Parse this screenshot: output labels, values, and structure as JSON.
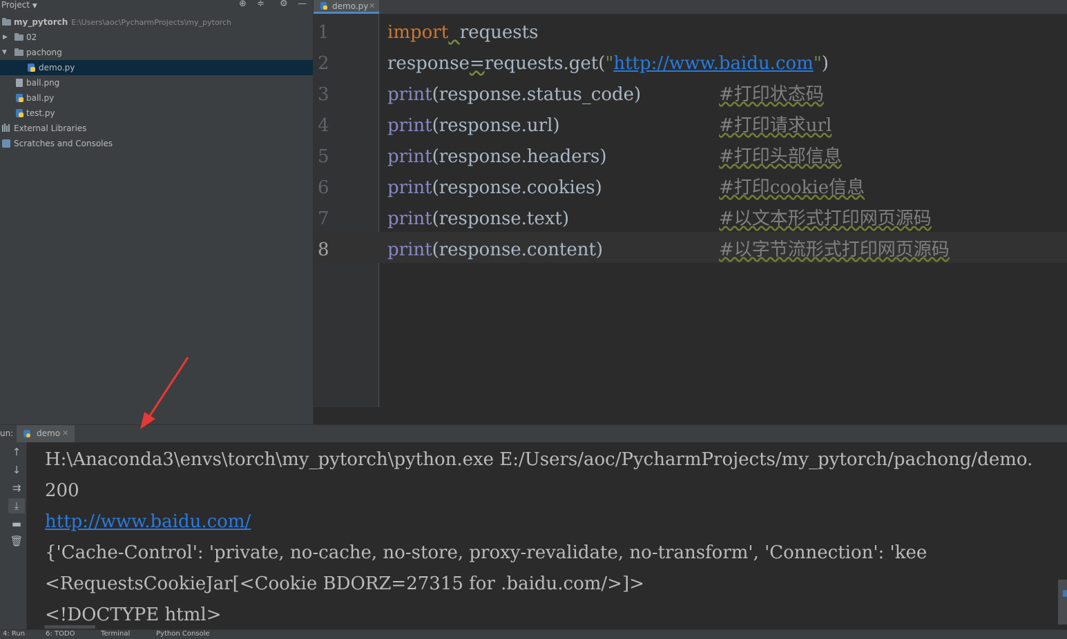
{
  "project_panel": {
    "title": "Project",
    "toolbar_icons": [
      "locate-icon",
      "collapse-icon",
      "gear-icon",
      "minimize-icon"
    ],
    "root": {
      "name": "my_pytorch",
      "path": "E:\\Users\\aoc\\PycharmProjects\\my_pytorch"
    },
    "items": [
      {
        "label": "02"
      },
      {
        "label": "pachong"
      },
      {
        "label": "demo.py"
      },
      {
        "label": "ball.png"
      },
      {
        "label": "ball.py"
      },
      {
        "label": "test.py"
      },
      {
        "label": "External Libraries"
      },
      {
        "label": "Scratches and Consoles"
      }
    ]
  },
  "editor": {
    "active_tab": "demo.py",
    "line_numbers": [
      "1",
      "2",
      "3",
      "4",
      "5",
      "6",
      "7",
      "8"
    ],
    "current_line": 8,
    "lines": [
      {
        "kw": "import",
        "space": "  ",
        "rest": "requests"
      },
      {
        "pre": "response",
        "eq": "=",
        "mid": "requests.get(",
        "q1": "\"",
        "url": "http://www.baidu.com",
        "q2": "\"",
        "post": ")"
      },
      {
        "fn": "print",
        "arg": "(response.status_code)",
        "comment": "#打印状态码"
      },
      {
        "fn": "print",
        "arg": "(response.url)",
        "comment": "#打印请求url"
      },
      {
        "fn": "print",
        "arg": "(response.headers)",
        "comment": "#打印头部信息"
      },
      {
        "fn": "print",
        "arg": "(response.cookies)",
        "comment": "#打印cookie信息"
      },
      {
        "fn": "print",
        "arg": "(response.text)",
        "comment": "#以文本形式打印网页源码"
      },
      {
        "fn": "print",
        "arg": "(response.content)",
        "comment": "#以字节流形式打印网页源码"
      }
    ]
  },
  "run": {
    "label": "un:",
    "tab": "demo",
    "toolbar_icons": [
      "up-arrow-icon",
      "down-arrow-icon",
      "soft-wrap-icon",
      "scroll-to-end-icon",
      "print-icon",
      "trash-icon"
    ],
    "output": [
      "H:\\Anaconda3\\envs\\torch\\my_pytorch\\python.exe E:/Users/aoc/PycharmProjects/my_pytorch/pachong/demo.",
      "200",
      "http://www.baidu.com/",
      "{'Cache-Control': 'private, no-cache, no-store, proxy-revalidate, no-transform', 'Connection': 'kee",
      "<RequestsCookieJar[<Cookie BDORZ=27315 for .baidu.com/>]>",
      "<!DOCTYPE html>"
    ]
  },
  "status_bar": {
    "items": [
      "4: Run",
      "6: TODO",
      "Terminal",
      "Python Console"
    ]
  },
  "colors": {
    "keyword": "#cc7832",
    "string": "#6a8759",
    "builtin": "#8888c6",
    "comment": "#808080",
    "link": "#287bde",
    "annotation_arrow": "#e53935"
  }
}
